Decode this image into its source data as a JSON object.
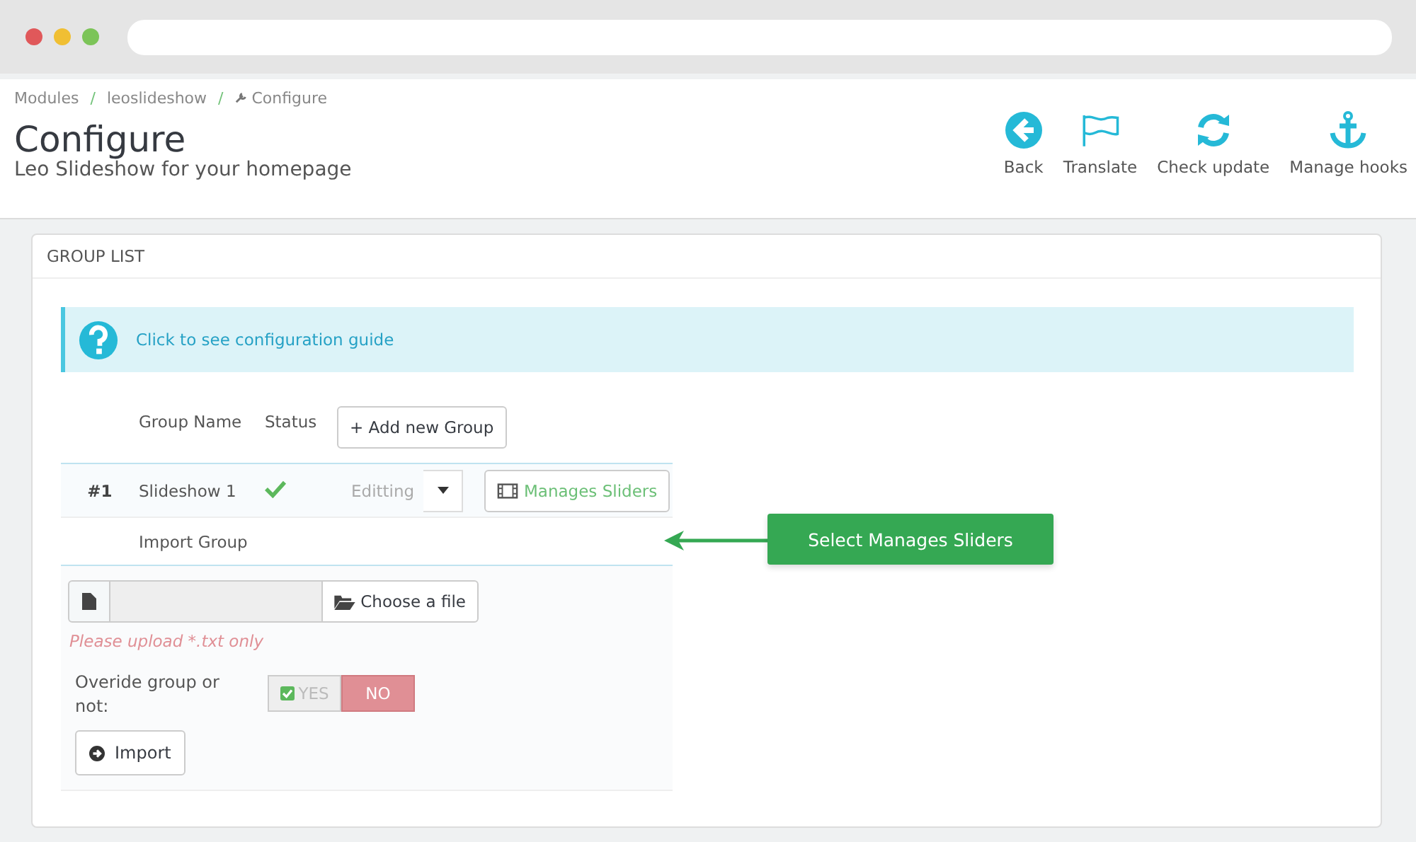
{
  "breadcrumb_separator": "/",
  "breadcrumb": [
    {
      "label": "Modules",
      "icon": false
    },
    {
      "label": "leoslideshow",
      "icon": false
    },
    {
      "label": "Configure",
      "icon": true
    }
  ],
  "title": "Configure",
  "subtitle": "Leo Slideshow for your homepage",
  "toolbar": [
    {
      "kind": "back",
      "label": "Back"
    },
    {
      "kind": "flag",
      "label": "Translate"
    },
    {
      "kind": "refresh",
      "label": "Check update"
    },
    {
      "kind": "anchor",
      "label": "Manage hooks"
    }
  ],
  "panel": {
    "heading": "GROUP LIST",
    "guide_link": "Click to see configuration guide",
    "columns": [
      "Group Name",
      "Status"
    ],
    "add_button": "+ Add new Group",
    "rows": [
      {
        "number": "#1",
        "name": "Slideshow 1",
        "enabled": true,
        "edit_button": "Editting",
        "manage_button": "Manages Sliders"
      }
    ],
    "import_label": "Import Group",
    "choose_file": "Choose a file",
    "file_hint": "Please upload *.txt only",
    "override_label": "Overide group or not:",
    "override_options": [
      {
        "label": "YES",
        "selected": false
      },
      {
        "label": "NO",
        "selected": true
      }
    ],
    "import_button": "Import"
  },
  "callout": "Select Manages Sliders"
}
